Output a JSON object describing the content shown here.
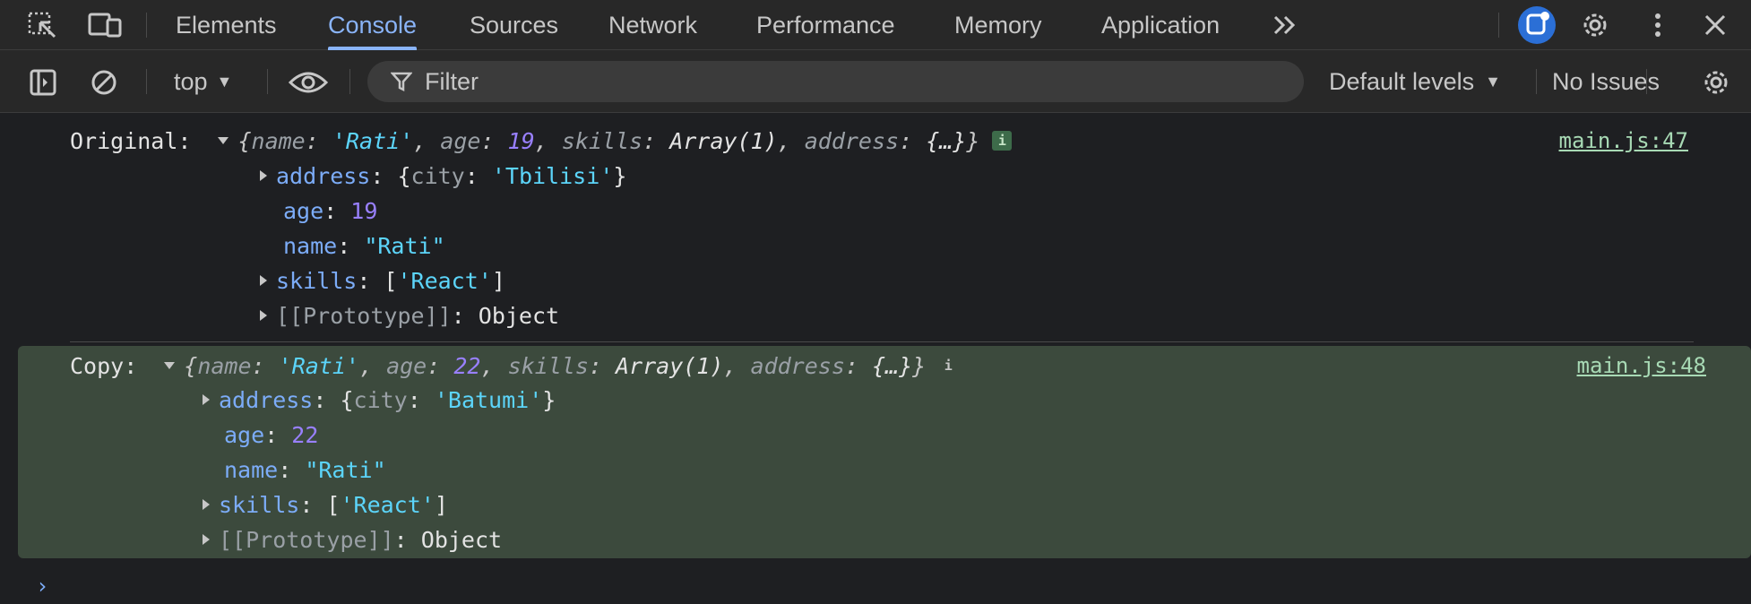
{
  "tabs": [
    {
      "label": "Elements"
    },
    {
      "label": "Console",
      "active": true
    },
    {
      "label": "Sources"
    },
    {
      "label": "Network"
    },
    {
      "label": "Performance"
    },
    {
      "label": "Memory"
    },
    {
      "label": "Application"
    }
  ],
  "toolbar": {
    "context": "top",
    "filter_placeholder": "Filter",
    "levels": "Default levels",
    "issues": "No Issues"
  },
  "messages": [
    {
      "label": "Original:",
      "source": "main.js:47",
      "preview": {
        "name_key": "name",
        "name_val": "'Rati'",
        "age_key": "age",
        "age_val": "19",
        "skills_key": "skills",
        "skills_val": "Array(1)",
        "address_key": "address",
        "address_val": "{…}"
      },
      "props": {
        "address_key": "address",
        "address_val": "'Tbilisi'",
        "age_key": "age",
        "age_val": "19",
        "name_key": "name",
        "name_val": "\"Rati\"",
        "skills_key": "skills",
        "skills_val": "'React'",
        "proto_key": "[[Prototype]]",
        "proto_val": "Object"
      }
    },
    {
      "label": "Copy:",
      "source": "main.js:48",
      "preview": {
        "name_key": "name",
        "name_val": "'Rati'",
        "age_key": "age",
        "age_val": "22",
        "skills_key": "skills",
        "skills_val": "Array(1)",
        "address_key": "address",
        "address_val": "{…}"
      },
      "props": {
        "address_key": "address",
        "address_val": "'Batumi'",
        "age_key": "age",
        "age_val": "22",
        "name_key": "name",
        "name_val": "\"Rati\"",
        "skills_key": "skills",
        "skills_val": "'React'",
        "proto_key": "[[Prototype]]",
        "proto_val": "Object"
      }
    }
  ],
  "static": {
    "city_key": "city",
    "info_badge": "i",
    "prompt": "›"
  }
}
